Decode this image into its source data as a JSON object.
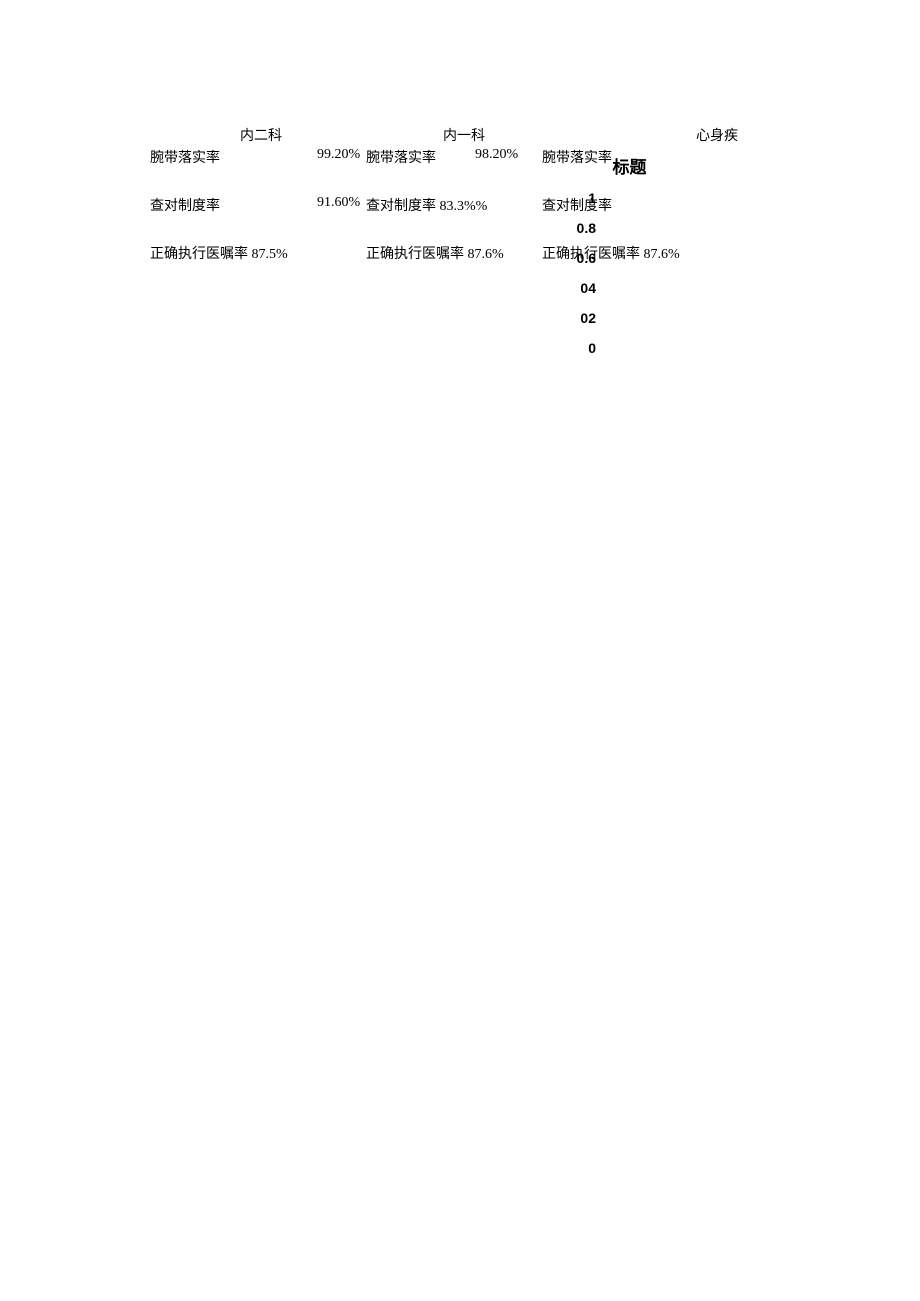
{
  "departments": {
    "dept1": "内二科",
    "dept2": "内一科",
    "dept3": "心身疾"
  },
  "metrics": {
    "row1": {
      "label": "腕带落实率",
      "dept1_value": "99.20%",
      "dept2_value": "98.20%",
      "dept3_value": ""
    },
    "row2": {
      "label": "查对制度率",
      "dept1_value": "91.60%",
      "dept2_label_value": "查对制度率 83.3%%",
      "dept3_value": ""
    },
    "row3": {
      "dept1_label_value": "正确执行医嘱率 87.5%",
      "dept2_label_value": "正确执行医嘱率 87.6%",
      "dept3_label_value": "正确执行医嘱率 87.6%"
    }
  },
  "chart_data": {
    "type": "bar",
    "title": "标题",
    "ylim": [
      0,
      1
    ],
    "y_ticks": [
      "1",
      "0.8",
      "0.6",
      "04",
      "02",
      "0"
    ],
    "categories": [],
    "values": []
  }
}
